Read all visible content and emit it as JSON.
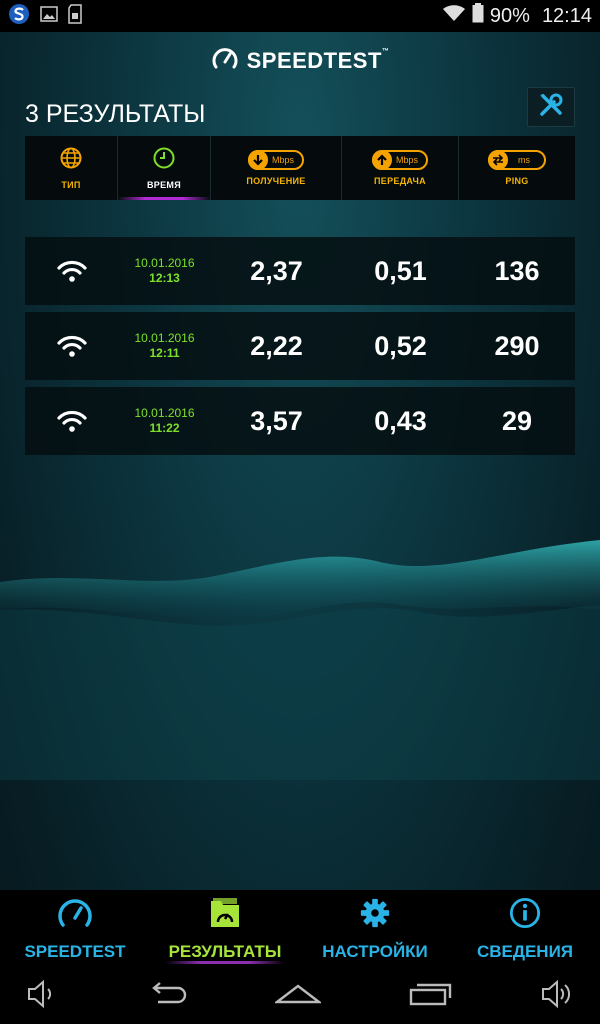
{
  "status_bar": {
    "battery": "90%",
    "time": "12:14"
  },
  "header": {
    "brand": "SPEEDTEST",
    "brand_tm": "™",
    "title": "3 РЕЗУЛЬТАТЫ"
  },
  "columns": [
    {
      "label": "ТИП",
      "icon": "globe-icon"
    },
    {
      "label": "ВРЕМЯ",
      "icon": "clock-icon",
      "active": true
    },
    {
      "label": "ПОЛУЧЕНИЕ",
      "icon": "download-icon",
      "unit": "Mbps"
    },
    {
      "label": "ПЕРЕДАЧА",
      "icon": "upload-icon",
      "unit": "Mbps"
    },
    {
      "label": "PING",
      "icon": "ping-icon",
      "unit": "ms"
    }
  ],
  "results": [
    {
      "type": "wifi-icon",
      "date": "10.01.2016",
      "time": "12:13",
      "download": "2,37",
      "upload": "0,51",
      "ping": "136"
    },
    {
      "type": "wifi-icon",
      "date": "10.01.2016",
      "time": "12:11",
      "download": "2,22",
      "upload": "0,52",
      "ping": "290"
    },
    {
      "type": "wifi-icon",
      "date": "10.01.2016",
      "time": "11:22",
      "download": "3,57",
      "upload": "0,43",
      "ping": "29"
    }
  ],
  "bottom_nav": [
    {
      "label": "SPEEDTEST",
      "icon": "speedometer-icon"
    },
    {
      "label": "РЕЗУЛЬТАТЫ",
      "icon": "results-folder-icon",
      "active": true
    },
    {
      "label": "НАСТРОЙКИ",
      "icon": "gear-icon"
    },
    {
      "label": "СВЕДЕНИЯ",
      "icon": "info-icon"
    }
  ],
  "colors": {
    "accent_orange": "#f4a300",
    "accent_green": "#7ee02a",
    "accent_blue": "#2ab3e6",
    "active_purple": "#b32bd6"
  }
}
